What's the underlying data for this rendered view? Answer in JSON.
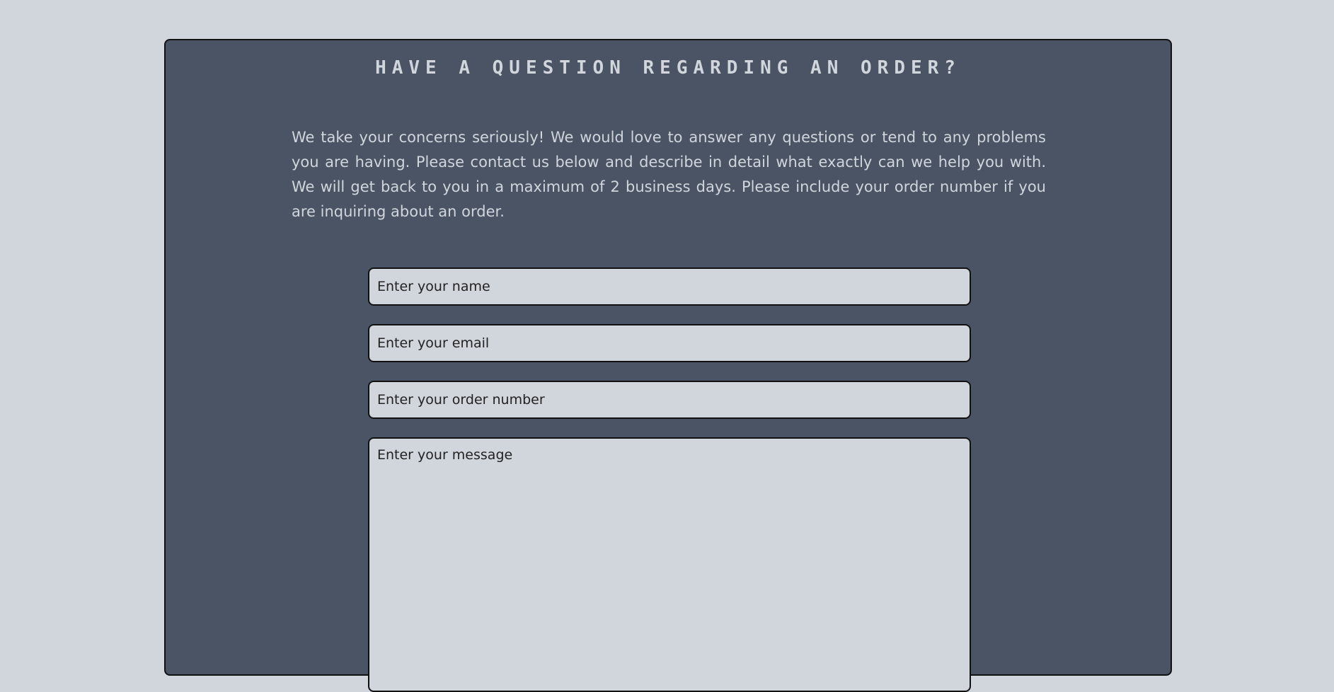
{
  "contact": {
    "heading": "Have a question regarding an order?",
    "intro": "We take your concerns seriously! We would love to answer any questions or tend to any problems you are having. Please contact us below and describe in detail what exactly can we help you with. We will get back to you in a maximum of 2 business days. Please include your order number if you are inquiring about an order.",
    "fields": {
      "name_placeholder": "Enter your name",
      "email_placeholder": "Enter your email",
      "order_placeholder": "Enter your order number",
      "message_placeholder": "Enter your message"
    }
  },
  "colors": {
    "page_background": "#d1d5dc",
    "card_background": "#4a5464",
    "text_light": "#d1d5dc",
    "border": "#111111"
  }
}
